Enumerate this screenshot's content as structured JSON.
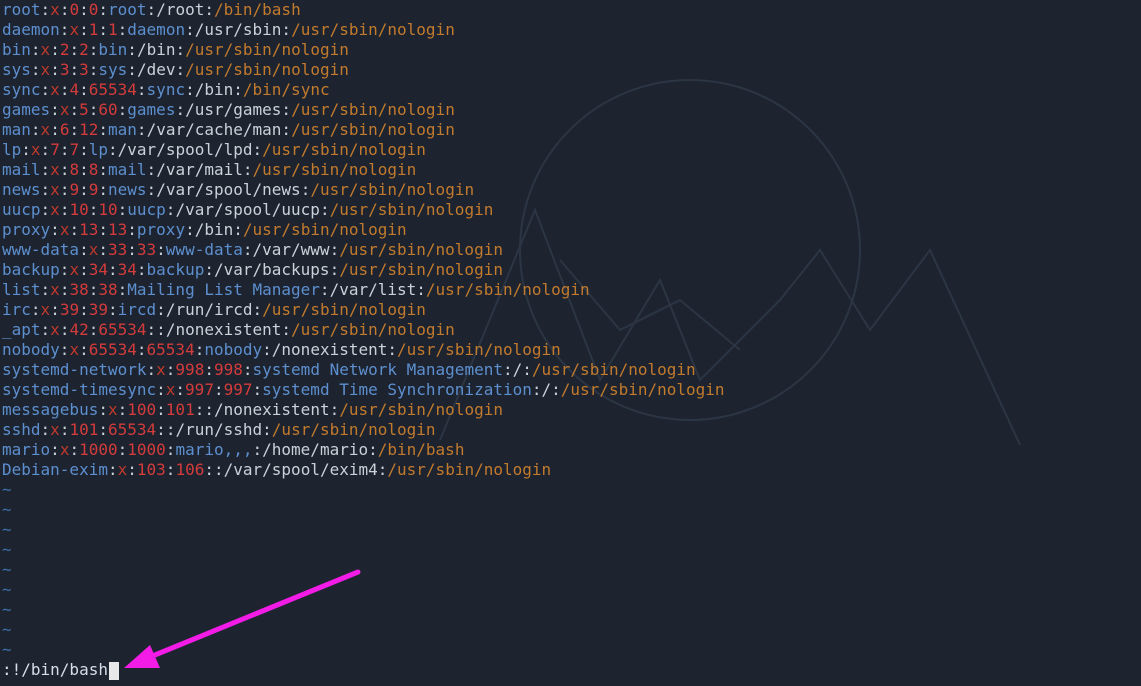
{
  "colors": {
    "background": "#1d2430",
    "name": "#5d8fcf",
    "separator": "#c9d1d9",
    "password": "#c0392b",
    "number": "#d43b3b",
    "home": "#c9d1d9",
    "shell": "#c27a2c",
    "tilde": "#3d6ea8",
    "arrow": "#f21ce6",
    "watermark": "#2c3543"
  },
  "passwd_lines": [
    [
      "root",
      "x",
      "0",
      "0",
      "root",
      "/root",
      "/bin/bash"
    ],
    [
      "daemon",
      "x",
      "1",
      "1",
      "daemon",
      "/usr/sbin",
      "/usr/sbin/nologin"
    ],
    [
      "bin",
      "x",
      "2",
      "2",
      "bin",
      "/bin",
      "/usr/sbin/nologin"
    ],
    [
      "sys",
      "x",
      "3",
      "3",
      "sys",
      "/dev",
      "/usr/sbin/nologin"
    ],
    [
      "sync",
      "x",
      "4",
      "65534",
      "sync",
      "/bin",
      "/bin/sync"
    ],
    [
      "games",
      "x",
      "5",
      "60",
      "games",
      "/usr/games",
      "/usr/sbin/nologin"
    ],
    [
      "man",
      "x",
      "6",
      "12",
      "man",
      "/var/cache/man",
      "/usr/sbin/nologin"
    ],
    [
      "lp",
      "x",
      "7",
      "7",
      "lp",
      "/var/spool/lpd",
      "/usr/sbin/nologin"
    ],
    [
      "mail",
      "x",
      "8",
      "8",
      "mail",
      "/var/mail",
      "/usr/sbin/nologin"
    ],
    [
      "news",
      "x",
      "9",
      "9",
      "news",
      "/var/spool/news",
      "/usr/sbin/nologin"
    ],
    [
      "uucp",
      "x",
      "10",
      "10",
      "uucp",
      "/var/spool/uucp",
      "/usr/sbin/nologin"
    ],
    [
      "proxy",
      "x",
      "13",
      "13",
      "proxy",
      "/bin",
      "/usr/sbin/nologin"
    ],
    [
      "www-data",
      "x",
      "33",
      "33",
      "www-data",
      "/var/www",
      "/usr/sbin/nologin"
    ],
    [
      "backup",
      "x",
      "34",
      "34",
      "backup",
      "/var/backups",
      "/usr/sbin/nologin"
    ],
    [
      "list",
      "x",
      "38",
      "38",
      "Mailing List Manager",
      "/var/list",
      "/usr/sbin/nologin"
    ],
    [
      "irc",
      "x",
      "39",
      "39",
      "ircd",
      "/run/ircd",
      "/usr/sbin/nologin"
    ],
    [
      "_apt",
      "x",
      "42",
      "65534",
      "",
      "/nonexistent",
      "/usr/sbin/nologin"
    ],
    [
      "nobody",
      "x",
      "65534",
      "65534",
      "nobody",
      "/nonexistent",
      "/usr/sbin/nologin"
    ],
    [
      "systemd-network",
      "x",
      "998",
      "998",
      "systemd Network Management",
      "/",
      "/usr/sbin/nologin"
    ],
    [
      "systemd-timesync",
      "x",
      "997",
      "997",
      "systemd Time Synchronization",
      "/",
      "/usr/sbin/nologin"
    ],
    [
      "messagebus",
      "x",
      "100",
      "101",
      "",
      "/nonexistent",
      "/usr/sbin/nologin"
    ],
    [
      "sshd",
      "x",
      "101",
      "65534",
      "",
      "/run/sshd",
      "/usr/sbin/nologin"
    ],
    [
      "mario",
      "x",
      "1000",
      "1000",
      "mario,,,",
      "/home/mario",
      "/bin/bash"
    ],
    [
      "Debian-exim",
      "x",
      "103",
      "106",
      "",
      "/var/spool/exim4",
      "/usr/sbin/nologin"
    ]
  ],
  "empty_line_marker": "~",
  "empty_line_count": 9,
  "command_line": ":!/bin/bash",
  "arrow_icon": "arrow-pointing-to-command"
}
